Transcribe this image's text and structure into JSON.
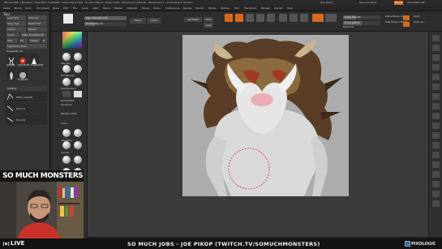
{
  "titlebar": {
    "text": "ZBrush 4R8 · [Monster] · Free Mem 19.836GB · Active Mem 1303 · Scratch Disk 8 · Timer 0.001 · PolyCount 2.081 KP · MeshCount 1 · QuickSave In 50 Secs",
    "quicksave": "QuickSave",
    "seethrough": "See-through 0",
    "menus_btn": "Menus",
    "default_script": "DefaultZScript"
  },
  "menu_bar": [
    "Alpha",
    "Brush",
    "Color",
    "Document",
    "Draw",
    "Edit",
    "File",
    "Layer",
    "Light",
    "Macro",
    "Marker",
    "Material",
    "Movie",
    "Picker",
    "Preferences",
    "Render",
    "Stencil",
    "Stroke",
    "Texture",
    "Tool",
    "Transform",
    "Zplugin",
    "Zscript",
    "Help"
  ],
  "tool_panel": {
    "title": "Tool",
    "buttons": [
      "Load Tool",
      "Save As",
      "Copy Tool",
      "Paste Tool",
      "Import",
      "Export",
      "Clone",
      "Make PolyMesh3D",
      "GoZ",
      "All",
      "Visible",
      "R"
    ],
    "lightbox": "Lightbox ▸ Tools",
    "current_tool": "Simple3D. 50",
    "thumb_labels": [
      "SimpleB",
      "Cylinder3D",
      "PolyMesh3D",
      "Simple3D"
    ],
    "subtool_title": "Subtool",
    "subtools": [
      "PM3D_Cube3D",
      "Extract1",
      "Extract2"
    ]
  },
  "shelf": {
    "labels": [
      "Standard",
      "ClayBuildup",
      "Move",
      "hPolish",
      "TrimDynamic",
      "Inflat",
      "Snakehook",
      "DamStandard",
      "Pinch",
      "Flatten",
      "Move Elastic",
      "Transpose",
      "ClayTubes",
      "Smooth",
      "Layer"
    ],
    "sections": [
      "Backface Mask",
      "Curve",
      "Stroke"
    ]
  },
  "top_shelf": {
    "sliders": [
      {
        "label": "Rgb Intensity 100",
        "value": 100
      },
      {
        "label": "Z Intensity 25",
        "value": 25
      },
      {
        "label": "Draw Size 64",
        "value": 64
      },
      {
        "label": "Focal Shift 0",
        "value": 0
      },
      {
        "label": "Dynamic",
        "value": 0
      }
    ],
    "buttons": [
      "Move",
      "Scale",
      "Rotate",
      "Edit",
      "Draw",
      "Mrgb",
      "Rgb",
      "M",
      "Zadd",
      "Zsub",
      "Zcut",
      "Spotlight",
      "Dual",
      "Lazy"
    ],
    "right_labels": [
      "Active Points: 2.08 Mil",
      "Total Points: 2.08 Mil",
      "Quick",
      "Zoom Cu..."
    ]
  },
  "banner": {
    "brand": "SO MUCH MONSTERS"
  },
  "bottom": {
    "live": "LIVE",
    "credit": "SO MUCH JOBS - JOE PIKOP (TWITCH.TV/SOMUCHMONSTERS)",
    "pixologic": "PIXOLOGIC"
  },
  "colors": {
    "accent": "#d96a1a",
    "brand_red": "#e2261e",
    "canvas_bg": "#acacac",
    "ui_dark": "#2f2f2f"
  }
}
